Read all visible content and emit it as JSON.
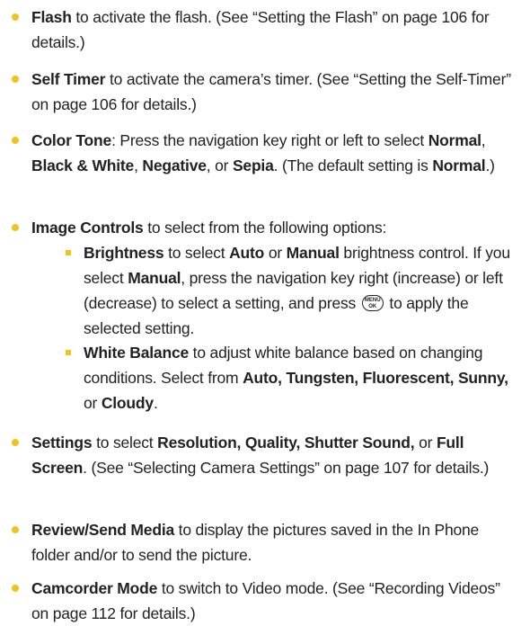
{
  "items": [
    {
      "term": "Flash",
      "text": " to activate the flash. (See “Setting the Flash” on page 106 for details.)"
    },
    {
      "term": "Self Timer",
      "text": " to activate the camera’s timer. (See “Setting the Self-Timer” on page 106 for details.)"
    },
    {
      "term": "Color Tone",
      "t1": ": Press the navigation key right or left to select ",
      "o1": "Normal",
      "s1": ", ",
      "o2": "Black & White",
      "s2": ", ",
      "o3": "Negative",
      "s3": ", or ",
      "o4": "Sepia",
      "s4": ". (The default setting is ",
      "o5": "Normal",
      "s5": ".)"
    },
    {
      "term": "Image Controls",
      "text": " to select from the following options:"
    },
    {
      "term": "Settings",
      "t1": " to select ",
      "o1": "Resolution, Quality, Shutter Sound,",
      "t2": " or ",
      "o2": "Full Screen",
      "t3": ". (See “Selecting Camera Settings” on page 107 for details.)"
    },
    {
      "term": "Review/Send Media",
      "text": " to display the pictures saved in the In Phone folder and/or to send the picture."
    },
    {
      "term": "Camcorder Mode",
      "text": " to switch to Video mode. (See “Recording Videos” on page 112 for details.)"
    }
  ],
  "subitems": [
    {
      "term": "Brightness",
      "t1": " to select ",
      "o1": "Auto",
      "t2": " or ",
      "o2": "Manual",
      "t3": " brightness control. If you select ",
      "o3": "Manual",
      "t4": ", press the navigation key right (increase) or left (decrease) to select a setting, and press ",
      "t5": " to apply the selected setting."
    },
    {
      "term": "White Balance",
      "t1": " to adjust white balance based on changing conditions. Select from ",
      "o1": "Auto, Tungsten, Fluorescent, Sunny,",
      "t2": " or ",
      "o2": "Cloudy",
      "t3": "."
    }
  ],
  "menu_key": {
    "top": "MENU",
    "bottom": "OK"
  },
  "colors": {
    "bullet": "#f2c21b",
    "text": "#222222"
  }
}
